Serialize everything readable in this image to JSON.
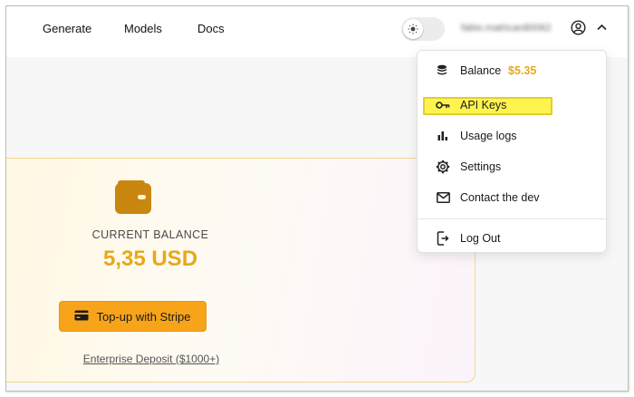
{
  "nav": {
    "generate": "Generate",
    "models": "Models",
    "docs": "Docs"
  },
  "header": {
    "username": "fabio.matricardi0062",
    "theme": "light"
  },
  "card": {
    "label": "CURRENT BALANCE",
    "amount": "5,35 USD",
    "topup_label": "Top-up with Stripe",
    "enterprise_label": "Enterprise Deposit ($1000+)"
  },
  "menu": {
    "balance_label": "Balance",
    "balance_value": "$5.35",
    "api_keys": "API Keys",
    "usage_logs": "Usage logs",
    "settings": "Settings",
    "contact": "Contact the dev",
    "logout": "Log Out"
  },
  "colors": {
    "accent": "#e6a918",
    "button": "#f8a41a",
    "highlight": "#fff44f"
  }
}
